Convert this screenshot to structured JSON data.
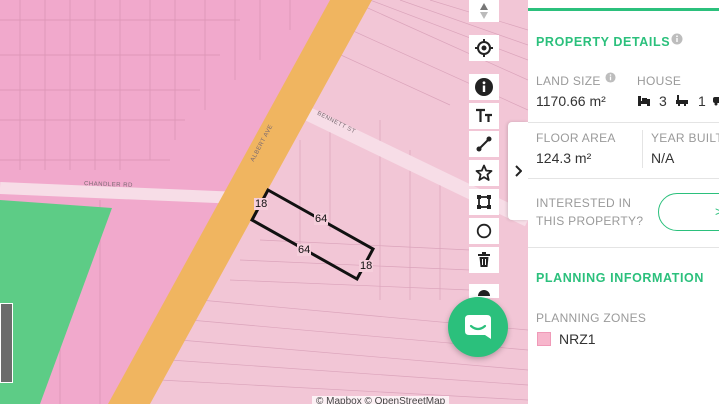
{
  "map": {
    "roads": {
      "albert": "ALBERT AVE",
      "bennett": "BENNETT ST",
      "chandler": "CHANDLER RD"
    },
    "dimensions": {
      "top_left": "18",
      "top_edge": "64",
      "bottom_edge": "64",
      "right": "18"
    },
    "attribution": "© Mapbox © OpenStreetMap",
    "zone_colors": {
      "residential": "#f2c6d6",
      "commercial": "#f1a9cc",
      "park": "#5dcc86",
      "main_road": "#f0b560"
    }
  },
  "toolbar": {
    "tools": [
      "compass-icon",
      "locate-icon",
      "info-icon",
      "text-tool-icon",
      "line-tool-icon",
      "star-tool-icon",
      "polygon-tool-icon",
      "circle-tool-icon",
      "trash-icon",
      "layers-icon"
    ]
  },
  "panel": {
    "property_details_title": "PROPERTY DETAILS",
    "land_size_label": "LAND SIZE",
    "land_size_value": "1170.66 m²",
    "house_label": "HOUSE",
    "bedrooms": "3",
    "bathrooms": "1",
    "floor_area_label": "FLOOR AREA",
    "floor_area_value": "124.3 m²",
    "year_built_label": "YEAR BUILT",
    "year_built_value": "N/A",
    "interested_label_line1": "INTERESTED IN",
    "interested_label_line2": "THIS PROPERTY?",
    "interested_button_label": ">",
    "planning_title": "PLANNING INFORMATION",
    "planning_zones_label": "PLANNING ZONES",
    "zone_name": "NRZ1",
    "accent_color": "#2bc07c"
  }
}
